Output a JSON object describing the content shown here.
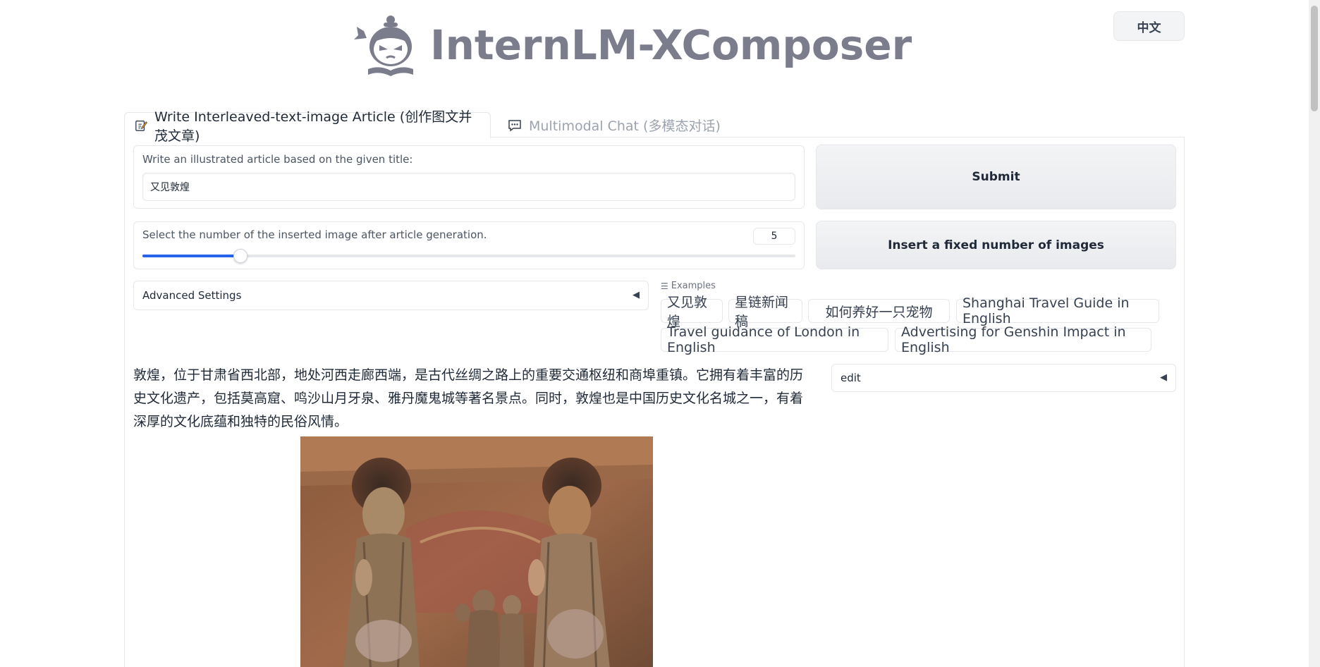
{
  "header": {
    "title": "InternLM-XComposer",
    "lang_button": "中文"
  },
  "tabs": [
    {
      "label": "Write Interleaved-text-image Article (创作图文并茂文章)",
      "active": true
    },
    {
      "label": "Multimodal Chat (多模态对话)",
      "active": false
    }
  ],
  "article_form": {
    "title_label": "Write an illustrated article based on the given title:",
    "title_value": "又见敦煌",
    "slider_label": "Select the number of the inserted image after article generation.",
    "slider_value": "5",
    "slider_fraction": 0.15,
    "submit_label": "Submit",
    "insert_label": "Insert a fixed number of images",
    "advanced_label": "Advanced Settings"
  },
  "examples": {
    "label": "Examples",
    "items": [
      "又见敦煌",
      "星链新闻稿",
      "如何养好一只宠物",
      "Shanghai Travel Guide in English",
      "Travel guidance of London in English",
      "Advertising for Genshin Impact in English"
    ]
  },
  "output": {
    "article_text": "敦煌，位于甘肃省西北部，地处河西走廊西端，是古代丝绸之路上的重要交通枢纽和商埠重镇。它拥有着丰富的历史文化遗产，包括莫高窟、鸣沙山月牙泉、雅丹魔鬼城等著名景点。同时，敦煌也是中国历史文化名城之一，有着深厚的文化底蕴和独特的民俗风情。",
    "edit_label": "edit"
  },
  "colors": {
    "accent": "#2563eb",
    "logo_text": "#7b7c8c"
  },
  "icons": {
    "tab_write": "pencil-note-icon",
    "tab_chat": "chat-bubble-icon",
    "collapse": "triangle-left-icon"
  }
}
